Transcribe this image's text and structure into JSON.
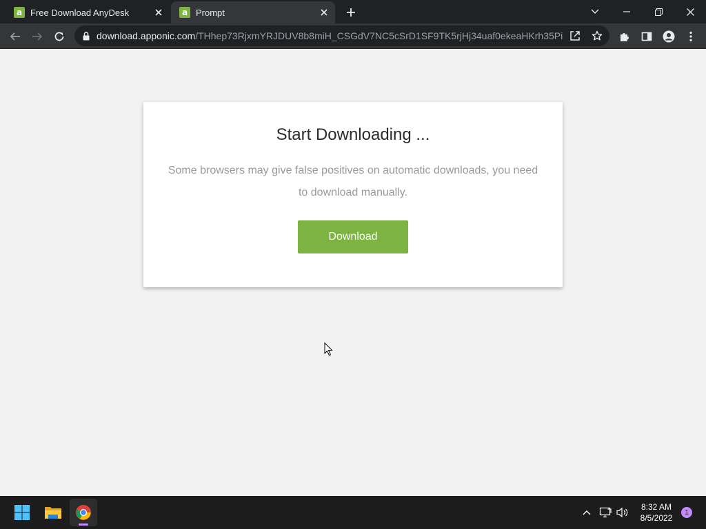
{
  "browser": {
    "tabs": [
      {
        "favicon_letter": "a",
        "title": "Free Download AnyDesk",
        "active": false
      },
      {
        "favicon_letter": "a",
        "title": "Prompt",
        "active": true
      }
    ],
    "address_bar": {
      "domain": "download.apponic.com",
      "path": "/THhep73RjxmYRJDUV8b8miH_CSGdV7NC5cSrD1SF9TK5rjHj34uaf0ekeaHKrh35PiP4..."
    }
  },
  "page": {
    "heading": "Start Downloading ...",
    "message": "Some browsers may give false positives on automatic downloads, you need to download manually.",
    "download_button_label": "Download"
  },
  "taskbar": {
    "apps": [
      "start-icon",
      "file-explorer-icon",
      "chrome-icon"
    ],
    "clock": {
      "time": "8:32 AM",
      "date": "8/5/2022"
    },
    "notification_count": "1"
  },
  "colors": {
    "accent_green": "#7cb342",
    "page_background": "#f2f2f2",
    "chrome_dark": "#202124",
    "toolbar": "#35363a"
  }
}
